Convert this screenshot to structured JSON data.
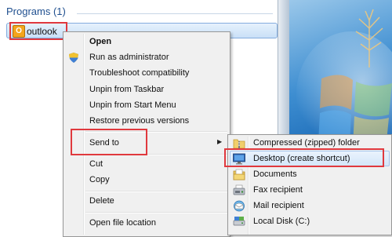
{
  "search_results": {
    "header": "Programs (1)",
    "program": {
      "label": "outlook",
      "icon": "outlook-icon"
    }
  },
  "context_menu": {
    "items": [
      {
        "label": "Open",
        "bold": true
      },
      {
        "label": "Run as administrator",
        "icon": "uac-shield-icon"
      },
      {
        "label": "Troubleshoot compatibility"
      },
      {
        "label": "Unpin from Taskbar"
      },
      {
        "label": "Unpin from Start Menu"
      },
      {
        "label": "Restore previous versions"
      },
      {
        "label": "Send to",
        "submenu_arrow": "▶"
      },
      {
        "label": "Cut"
      },
      {
        "label": "Copy"
      },
      {
        "label": "Delete"
      },
      {
        "label": "Open file location"
      }
    ]
  },
  "send_to_submenu": {
    "items": [
      {
        "label": "Compressed (zipped) folder",
        "icon": "zip-folder-icon"
      },
      {
        "label": "Desktop (create shortcut)",
        "icon": "desktop-icon",
        "highlighted": true
      },
      {
        "label": "Documents",
        "icon": "documents-icon"
      },
      {
        "label": "Fax recipient",
        "icon": "fax-icon"
      },
      {
        "label": "Mail recipient",
        "icon": "mail-icon"
      },
      {
        "label": "Local Disk (C:)",
        "icon": "local-disk-icon"
      }
    ]
  },
  "colors": {
    "annotation_red": "#e0393e",
    "selection_blue": "#84acdd",
    "menu_background": "#f0f0f0"
  }
}
